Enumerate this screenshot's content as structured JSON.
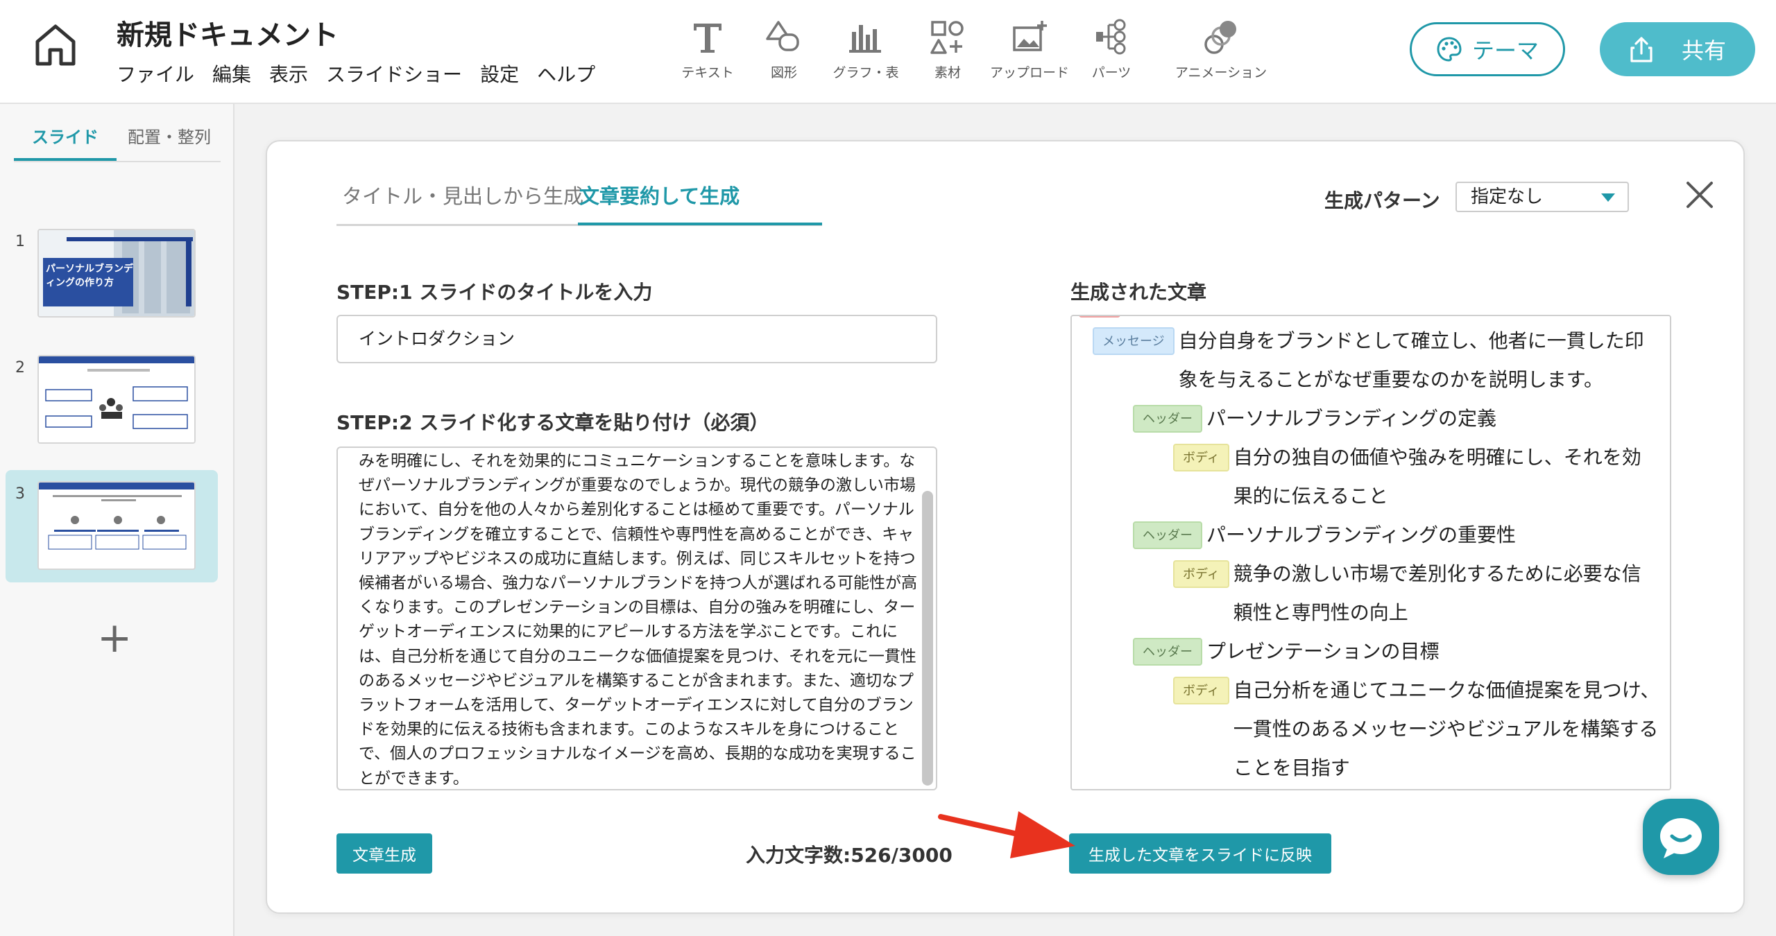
{
  "app": {
    "doc_title": "新規ドキュメント",
    "menu": [
      "ファイル",
      "編集",
      "表示",
      "スライドショー",
      "設定",
      "ヘルプ"
    ],
    "tools": [
      {
        "label": "テキスト",
        "icon": "text-icon"
      },
      {
        "label": "図形",
        "icon": "shapes-icon"
      },
      {
        "label": "グラフ・表",
        "icon": "chart-icon"
      },
      {
        "label": "素材",
        "icon": "assets-icon"
      },
      {
        "label": "アップロード",
        "icon": "upload-image-icon"
      },
      {
        "label": "パーツ",
        "icon": "parts-icon"
      },
      {
        "label": "アニメーション",
        "icon": "animation-icon"
      }
    ],
    "theme_label": "テーマ",
    "share_label": "共有",
    "accent_color": "#1f98a8"
  },
  "sidebar": {
    "tabs": [
      "スライド",
      "配置・整列"
    ],
    "active_tab": "スライド",
    "slides": [
      {
        "number": "1",
        "title": "パーソナルブランディングの作り方"
      },
      {
        "number": "2",
        "title": ""
      },
      {
        "number": "3",
        "title": ""
      }
    ],
    "selected_slide": "3",
    "add_label": "+"
  },
  "dialog": {
    "tabs": [
      "タイトル・見出しから生成",
      "文章要約して生成"
    ],
    "active_tab": "文章要約して生成",
    "pattern_label": "生成パターン",
    "pattern_value": "指定なし",
    "step1_label": "STEP:1 スライドのタイトルを入力",
    "step1_value": "イントロダクション",
    "step2_label": "STEP:2 スライド化する文章を貼り付け（必須）",
    "step2_text": "みを明確にし、それを効果的にコミュニケーションすることを意味します。なぜパーソナルブランディングが重要なのでしょうか。現代の競争の激しい市場において、自分を他の人々から差別化することは極めて重要です。パーソナルブランディングを確立することで、信頼性や専門性を高めることができ、キャリアアップやビジネスの成功に直結します。例えば、同じスキルセットを持つ候補者がいる場合、強力なパーソナルブランドを持つ人が選ばれる可能性が高くなります。このプレゼンテーションの目標は、自分の強みを明確にし、ターゲットオーディエンスに効果的にアピールする方法を学ぶことです。これには、自己分析を通じて自分のユニークな価値提案を見つけ、それを元に一貫性のあるメッセージやビジュアルを構築することが含まれます。また、適切なプラットフォームを活用して、ターゲットオーディエンスに対して自分のブランドを効果的に伝える技術も含まれます。このようなスキルを身につけることで、個人のプロフェッショナルなイメージを高め、長期的な成功を実現することができます。",
    "generated_label": "生成された文章",
    "generated": [
      {
        "tag": "メッセージ",
        "kind": "msg",
        "text": "自分自身をブランドとして確立し、他者に一貫した印象を与えることがなぜ重要なのかを説明します。"
      },
      {
        "tag": "ヘッダー",
        "kind": "hdr",
        "text": "パーソナルブランディングの定義"
      },
      {
        "tag": "ボディ",
        "kind": "body",
        "text": "自分の独自の価値や強みを明確にし、それを効果的に伝えること"
      },
      {
        "tag": "ヘッダー",
        "kind": "hdr",
        "text": "パーソナルブランディングの重要性"
      },
      {
        "tag": "ボディ",
        "kind": "body",
        "text": "競争の激しい市場で差別化するために必要な信頼性と専門性の向上"
      },
      {
        "tag": "ヘッダー",
        "kind": "hdr",
        "text": "プレゼンテーションの目標"
      },
      {
        "tag": "ボディ",
        "kind": "body",
        "text": "自己分析を通じてユニークな価値提案を見つけ、一貫性のあるメッセージやビジュアルを構築することを目指す"
      }
    ],
    "generate_button": "文章生成",
    "char_count": "入力文字数:526/3000",
    "apply_button": "生成した文章をスライドに反映"
  }
}
